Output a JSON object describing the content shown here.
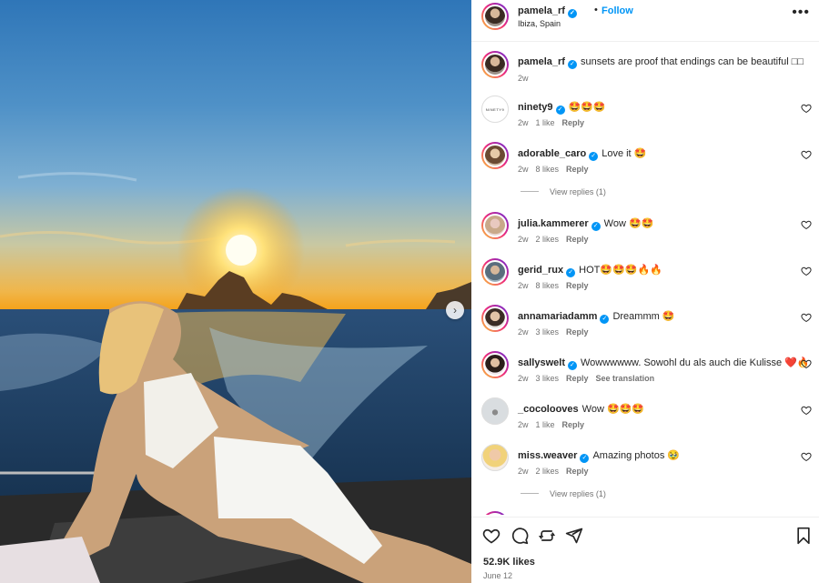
{
  "post": {
    "username": "pamela_rf",
    "follow_label": "Follow",
    "separator": "•",
    "location": "Ibiza, Spain",
    "more_label": "•••"
  },
  "caption": {
    "username": "pamela_rf",
    "text": "sunsets are proof that endings can be beautiful □□",
    "time": "2w"
  },
  "comments": [
    {
      "username": "ninety9",
      "text": "🤩🤩🤩",
      "time": "2w",
      "likes": "1 like",
      "reply": "Reply"
    },
    {
      "username": "adorable_caro",
      "text": "Love it 🤩",
      "time": "2w",
      "likes": "8 likes",
      "reply": "Reply",
      "view_replies": "View replies (1)"
    },
    {
      "username": "julia.kammerer",
      "text": "Wow 🤩🤩",
      "time": "2w",
      "likes": "2 likes",
      "reply": "Reply"
    },
    {
      "username": "gerid_rux",
      "text": "HOT🤩🤩🤩🔥🔥",
      "time": "2w",
      "likes": "8 likes",
      "reply": "Reply"
    },
    {
      "username": "annamariadamm",
      "text": "Dreammm 🤩",
      "time": "2w",
      "likes": "3 likes",
      "reply": "Reply"
    },
    {
      "username": "sallyswelt",
      "text": "Wowwwwww. Sowohl du als auch die Kulisse ❤️🔥",
      "time": "2w",
      "likes": "3 likes",
      "reply": "Reply",
      "translation": "See translation"
    },
    {
      "username": "_cocolooves",
      "text": "Wow 🤩🤩🤩",
      "time": "2w",
      "likes": "1 like",
      "reply": "Reply"
    },
    {
      "username": "miss.weaver",
      "text": "Amazing photos 🥹",
      "time": "2w",
      "likes": "2 likes",
      "reply": "Reply",
      "view_replies": "View replies (1)"
    }
  ],
  "ninety9_avatar_text": "NINETY9",
  "footer": {
    "likes": "52.9K likes",
    "date": "June 12"
  },
  "icons": {
    "verified": "verified-badge-icon",
    "heart": "heart-icon",
    "comment": "comment-icon",
    "share": "share-icon",
    "repost": "repost-icon",
    "save": "bookmark-icon",
    "next": "chevron-right-icon"
  },
  "colors": {
    "accent": "#0095f6",
    "text": "#262626",
    "muted": "#737373"
  }
}
